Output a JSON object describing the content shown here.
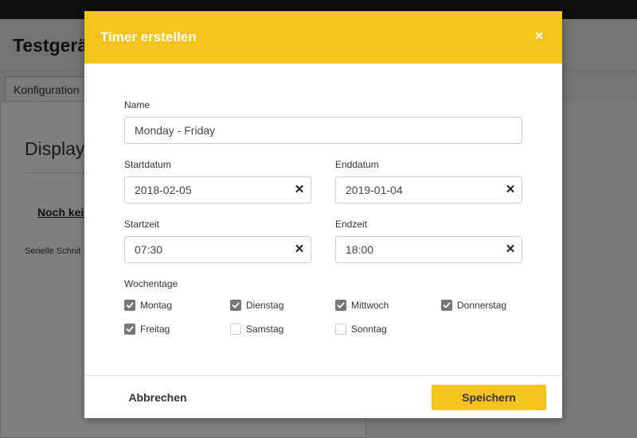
{
  "background": {
    "title": "Testgerä",
    "tab_label": "Konfiguration",
    "heading": "Display",
    "link_text": "Noch kein",
    "small_text": "Serielle Schnit"
  },
  "modal": {
    "title": "Timer erstellen",
    "close_symbol": "×",
    "name": {
      "label": "Name",
      "value": "Monday - Friday"
    },
    "start_date": {
      "label": "Startdatum",
      "value": "2018-02-05"
    },
    "end_date": {
      "label": "Enddatum",
      "value": "2019-01-04"
    },
    "start_time": {
      "label": "Startzeit",
      "value": "07:30"
    },
    "end_time": {
      "label": "Endzeit",
      "value": "18:00"
    },
    "clear_symbol": "✕",
    "weekdays_label": "Wochentage",
    "weekdays": [
      {
        "label": "Montag",
        "checked": true
      },
      {
        "label": "Dienstag",
        "checked": true
      },
      {
        "label": "Mittwoch",
        "checked": true
      },
      {
        "label": "Donnerstag",
        "checked": true
      },
      {
        "label": "Freitag",
        "checked": true
      },
      {
        "label": "Samstag",
        "checked": false
      },
      {
        "label": "Sonntag",
        "checked": false
      }
    ],
    "cancel_label": "Abbrechen",
    "save_label": "Speichern"
  },
  "colors": {
    "accent": "#f5c31d",
    "checkbox_checked": "#777777",
    "overlay": "rgba(0,0,0,0.5)"
  },
  "icons": {
    "close": "close-icon",
    "clear": "clear-icon",
    "check": "check-icon"
  }
}
